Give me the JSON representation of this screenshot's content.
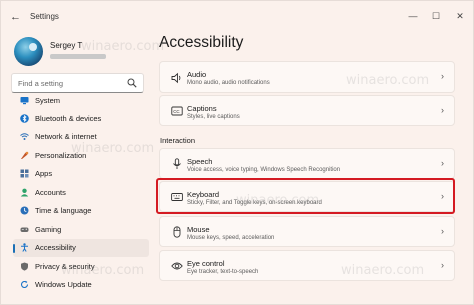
{
  "window": {
    "title": "Settings",
    "back": "←",
    "minimize": "—",
    "maximize": "☐",
    "close": "✕"
  },
  "profile": {
    "name": "Sergey T"
  },
  "search": {
    "placeholder": "Find a setting"
  },
  "sidebar": {
    "items": [
      {
        "label": "System",
        "icon": "system-icon",
        "color": "#1a73c8"
      },
      {
        "label": "Bluetooth & devices",
        "icon": "bluetooth-icon",
        "color": "#1a73c8"
      },
      {
        "label": "Network & internet",
        "icon": "network-icon",
        "color": "#2a6fb8"
      },
      {
        "label": "Personalization",
        "icon": "personalization-icon",
        "color": "#c2552a"
      },
      {
        "label": "Apps",
        "icon": "apps-icon",
        "color": "#4a6f9a"
      },
      {
        "label": "Accounts",
        "icon": "accounts-icon",
        "color": "#2ea36a"
      },
      {
        "label": "Time & language",
        "icon": "time-language-icon",
        "color": "#2a6fb8"
      },
      {
        "label": "Gaming",
        "icon": "gaming-icon",
        "color": "#6a6a6a"
      },
      {
        "label": "Accessibility",
        "icon": "accessibility-icon",
        "color": "#1a73c8"
      },
      {
        "label": "Privacy & security",
        "icon": "privacy-icon",
        "color": "#6a6a6a"
      },
      {
        "label": "Windows Update",
        "icon": "windows-update-icon",
        "color": "#1a73c8"
      }
    ],
    "active": "Accessibility"
  },
  "main": {
    "title": "Accessibility",
    "section_interaction": "Interaction",
    "cards": [
      {
        "title": "Audio",
        "subtitle": "Mono audio, audio notifications",
        "icon": "audio-icon"
      },
      {
        "title": "Captions",
        "subtitle": "Styles, live captions",
        "icon": "captions-icon"
      },
      {
        "title": "Speech",
        "subtitle": "Voice access, voice typing, Windows Speech Recognition",
        "icon": "microphone-icon"
      },
      {
        "title": "Keyboard",
        "subtitle": "Sticky, Filter, and Toggle keys, on-screen keyboard",
        "icon": "keyboard-icon"
      },
      {
        "title": "Mouse",
        "subtitle": "Mouse keys, speed, acceleration",
        "icon": "mouse-icon"
      },
      {
        "title": "Eye control",
        "subtitle": "Eye tracker, text-to-speech",
        "icon": "eye-icon"
      }
    ],
    "chevron": "›"
  },
  "watermark": "winaero.com",
  "colors": {
    "accent": "#1a6fb5",
    "highlight": "#d41a22",
    "background": "#fbf1ec"
  }
}
